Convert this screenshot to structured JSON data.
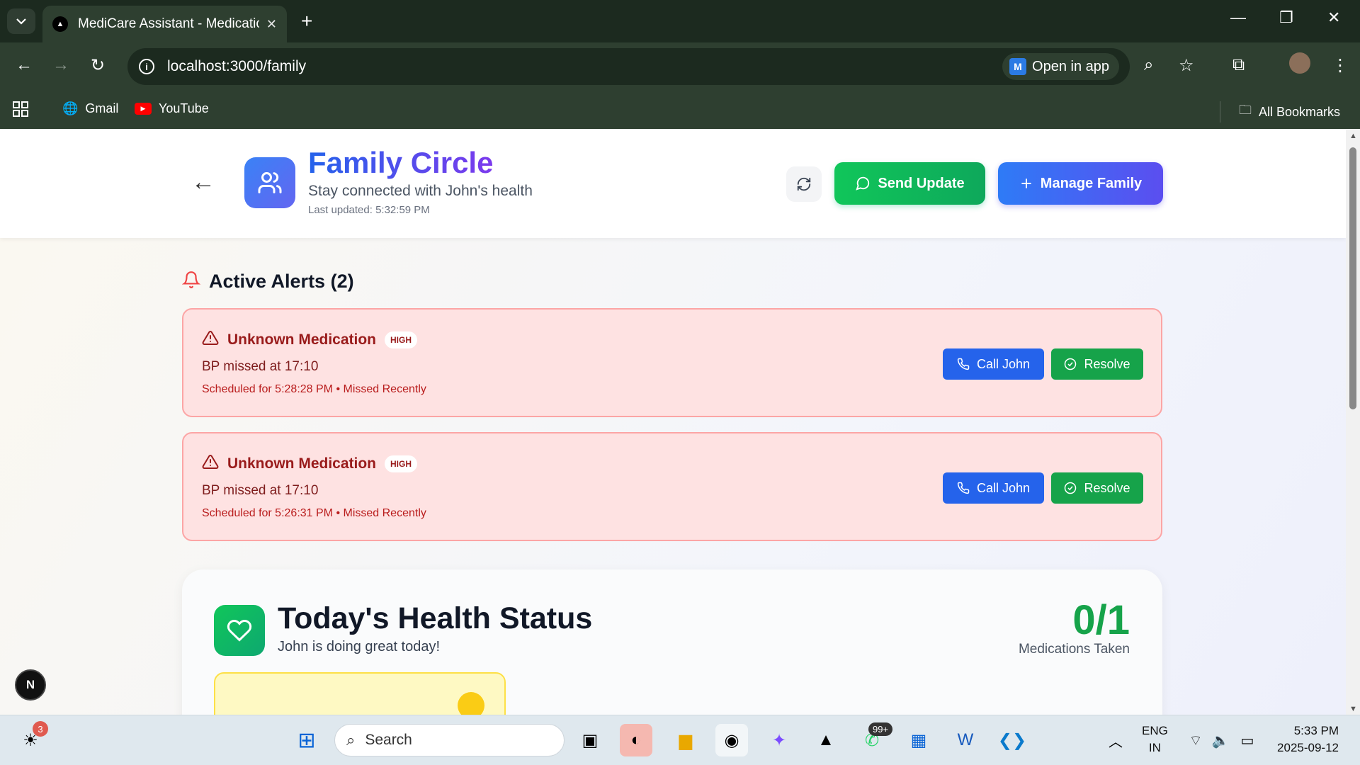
{
  "browser": {
    "tab_title": "MediCare Assistant - Medicatio",
    "url": "localhost:3000/family",
    "open_in_app": "Open in app",
    "bookmarks": [
      {
        "label": "Gmail"
      },
      {
        "label": "YouTube"
      }
    ],
    "all_bookmarks": "All Bookmarks"
  },
  "header": {
    "title": "Family Circle",
    "subtitle": "Stay connected with John's health",
    "last_updated": "Last updated: 5:32:59 PM",
    "send_update_label": "Send Update",
    "manage_family_label": "Manage Family"
  },
  "alerts": {
    "heading": "Active Alerts (2)",
    "items": [
      {
        "title": "Unknown Medication",
        "severity": "HIGH",
        "message": "BP missed at 17:10",
        "meta": "Scheduled for 5:28:28 PM • Missed Recently",
        "call_label": "Call John",
        "resolve_label": "Resolve"
      },
      {
        "title": "Unknown Medication",
        "severity": "HIGH",
        "message": "BP missed at 17:10",
        "meta": "Scheduled for 5:26:31 PM • Missed Recently",
        "call_label": "Call John",
        "resolve_label": "Resolve"
      }
    ]
  },
  "health": {
    "title": "Today's Health Status",
    "subtitle": "John is doing great today!",
    "count": "0/1",
    "count_label": "Medications Taken"
  },
  "next_badge": "N",
  "taskbar": {
    "search_placeholder": "Search",
    "notif_count": "3",
    "whatsapp_badge": "99+",
    "lang_top": "ENG",
    "lang_bottom": "IN",
    "time": "5:33 PM",
    "date": "2025-09-12"
  },
  "colors": {
    "primary_blue": "#2563eb",
    "success_green": "#16a34a",
    "alert_bg": "#fee2e2",
    "alert_border": "#fca5a5",
    "alert_text": "#991b1b"
  }
}
